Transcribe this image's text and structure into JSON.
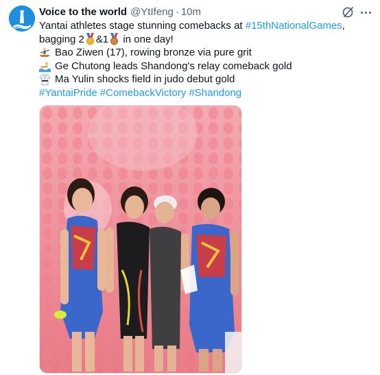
{
  "author": {
    "name": "Voice to the world",
    "handle": "@YtIfeng",
    "separator": "·",
    "time": "10m"
  },
  "tweet": {
    "line1_before": "Yantai athletes stage stunning comebacks at ",
    "line1_tag": "#15thNationalGames",
    "line1_after": ",",
    "line2_before": "bagging 2",
    "line2_mid": "&1",
    "line2_after": " in one day!",
    "item1": "Bao Ziwen (17), rowing bronze via pure grit",
    "item2": "Ge Chutong leads Shandong's relay comeback gold",
    "item3": "Ma Yulin shocks field in judo debut gold",
    "hashtags": [
      "#YantaiPride",
      "#ComebackVictory",
      "#Shandong"
    ]
  },
  "icons": {
    "gold_medal": "gold-medal-icon",
    "bronze_medal": "bronze-medal-icon",
    "rowing": "rowing-icon",
    "swimmer": "swimmer-icon",
    "judo": "martial-arts-uniform-icon",
    "grok": "grok-icon",
    "more": "more-icon"
  },
  "colors": {
    "link": "#1d9bf0",
    "muted": "#536471",
    "avatar_bg": "#1d8fe0",
    "photo_bg": "#e88b95"
  }
}
